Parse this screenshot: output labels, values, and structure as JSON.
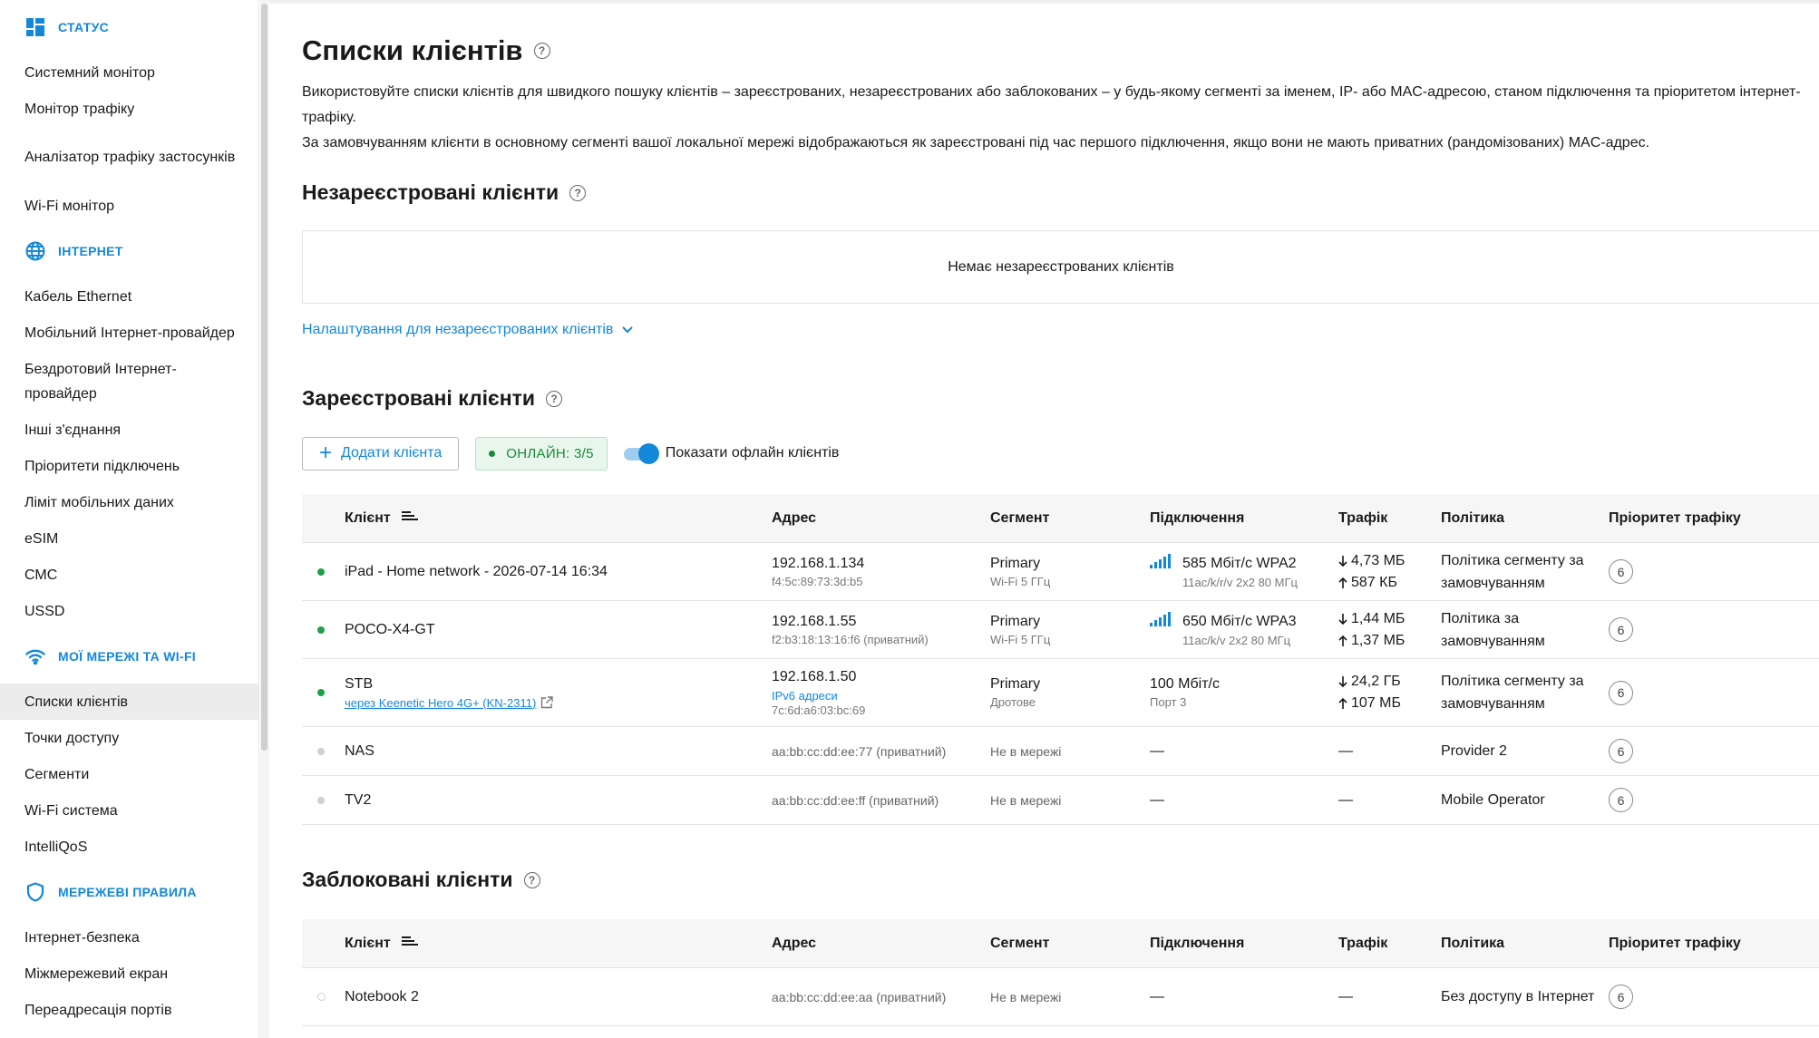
{
  "sidebar": {
    "sections": [
      {
        "title": "СТАТУС",
        "icon": "dashboard-icon",
        "items": [
          "Системний монітор",
          "Монітор трафіку",
          "Аналізатор трафіку застосунків",
          "Wi-Fi монітор"
        ]
      },
      {
        "title": "ІНТЕРНЕТ",
        "icon": "globe-icon",
        "items": [
          "Кабель Ethernet",
          "Мобільний Інтернет-провайдер",
          "Бездротовий Інтернет-провайдер",
          "Інші з'єднання",
          "Пріоритети підключень",
          "Ліміт мобільних даних",
          "eSIM",
          "СМС",
          "USSD"
        ]
      },
      {
        "title": "МОЇ МЕРЕЖІ ТА WI-FI",
        "icon": "wifi-icon",
        "items": [
          "Списки клієнтів",
          "Точки доступу",
          "Сегменти",
          "Wi-Fi система",
          "IntelliQoS"
        ]
      },
      {
        "title": "МЕРЕЖЕВІ ПРАВИЛА",
        "icon": "shield-icon",
        "items": [
          "Інтернет-безпека",
          "Міжмережевий екран",
          "Переадресація портів"
        ]
      }
    ]
  },
  "page": {
    "title": "Списки клієнтів",
    "desc1": "Використовуйте списки клієнтів для швидкого пошуку клієнтів – зареєстрованих, незареєстрованих або заблокованих – у будь-якому сегменті за іменем, IP- або MAC-адресою, станом підключення та пріоритетом інтернет-трафіку.",
    "desc2": "За замовчуванням клієнти в основному сегменті вашої локальної мережі відображаються як зареєстровані під час першого підключення, якщо вони не мають приватних (рандомізованих) MAC-адрес."
  },
  "unregistered": {
    "title": "Незареєстровані клієнти",
    "empty": "Немає незареєстрованих клієнтів",
    "settings_link": "Налаштування для незареєстрованих клієнтів"
  },
  "registered": {
    "title": "Зареєстровані клієнти",
    "add_button": "Додати клієнта",
    "online_badge": "ОНЛАЙН: 3/5",
    "toggle_label": "Показати офлайн клієнтів"
  },
  "table_headers": {
    "client": "Клієнт",
    "address": "Адрес",
    "segment": "Сегмент",
    "connection": "Підключення",
    "traffic": "Трафік",
    "policy": "Політика",
    "priority": "Пріоритет трафіку"
  },
  "registered_rows": [
    {
      "status": "online",
      "name": "iPad - Home network - 2026-07-14 16:34",
      "ip": "192.168.1.134",
      "mac": "f4:5c:89:73:3d:b5",
      "segment": "Primary",
      "segment_sub": "Wi-Fi 5 ГГц",
      "conn": "585 Мбіт/с  WPA2",
      "conn_sub": "11ac/k/r/v 2x2 80 МГц",
      "down": "4,73 МБ",
      "up": "587 КБ",
      "policy": "Політика сегменту за замовчуванням",
      "priority": "6"
    },
    {
      "status": "online",
      "name": "POCO-X4-GT",
      "ip": "192.168.1.55",
      "mac": "f2:b3:18:13:16:f6 (приватний)",
      "segment": "Primary",
      "segment_sub": "Wi-Fi 5 ГГц",
      "conn": "650 Мбіт/с  WPA3",
      "conn_sub": "11ac/k/v 2x2 80 МГц",
      "down": "1,44 МБ",
      "up": "1,37 МБ",
      "policy": "Політика за замовчуванням",
      "priority": "6"
    },
    {
      "status": "online",
      "name": "STB",
      "via": "через Keenetic Hero 4G+ (KN-2311)",
      "ip": "192.168.1.50",
      "ipv6": "IPv6 адреси",
      "mac": "7c:6d:a6:03:bc:69",
      "segment": "Primary",
      "segment_sub": "Дротове",
      "conn": "100 Мбіт/с",
      "conn_sub": "Порт 3",
      "down": "24,2 ГБ",
      "up": "107 МБ",
      "policy": "Політика сегменту за замовчуванням",
      "priority": "6"
    },
    {
      "status": "offline",
      "name": "NAS",
      "mac": "aa:bb:cc:dd:ee:77 (приватний)",
      "segment_off": "Не в мережі",
      "conn_dash": "—",
      "traf_dash": "—",
      "policy": "Provider 2",
      "priority": "6"
    },
    {
      "status": "offline",
      "name": "TV2",
      "mac": "aa:bb:cc:dd:ee:ff (приватний)",
      "segment_off": "Не в мережі",
      "conn_dash": "—",
      "traf_dash": "—",
      "policy": "Mobile Operator",
      "priority": "6"
    }
  ],
  "blocked": {
    "title": "Заблоковані клієнти",
    "rows": [
      {
        "status": "blocked",
        "name": "Notebook 2",
        "mac": "aa:bb:cc:dd:ee:aa (приватний)",
        "segment_off": "Не в мережі",
        "conn_dash": "—",
        "traf_dash": "—",
        "policy": "Без доступу в Інтернет",
        "priority": "6"
      }
    ]
  },
  "colors": {
    "accent": "#1488d8",
    "online": "#1ea04b",
    "offline": "#d0d0d0"
  }
}
